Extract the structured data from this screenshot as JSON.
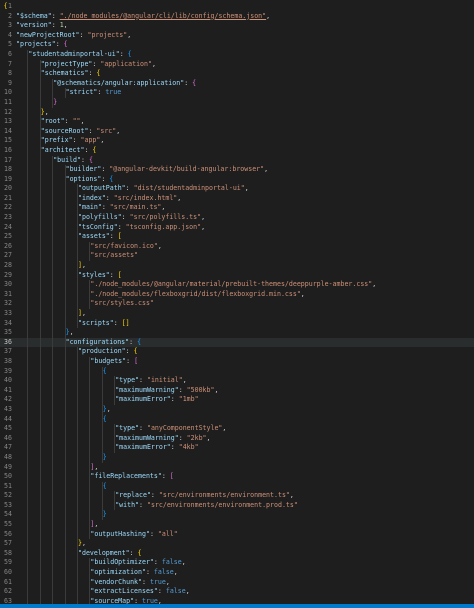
{
  "editor": {
    "file_language": "json",
    "active_line": 36,
    "lines": [
      {
        "n": "1",
        "ind": 0,
        "segs": [
          [
            "{",
            "b0"
          ]
        ]
      },
      {
        "n": "2",
        "ind": 1,
        "segs": [
          [
            "\"$schema\"",
            "key"
          ],
          [
            ": ",
            "p"
          ],
          [
            "\"./node_modules/@angular/cli/lib/config/schema.json\"",
            "link"
          ],
          [
            ",",
            "p"
          ]
        ]
      },
      {
        "n": "3",
        "ind": 1,
        "segs": [
          [
            "\"version\"",
            "key"
          ],
          [
            ": ",
            "p"
          ],
          [
            "1",
            "num"
          ],
          [
            ",",
            "p"
          ]
        ]
      },
      {
        "n": "4",
        "ind": 1,
        "segs": [
          [
            "\"newProjectRoot\"",
            "key"
          ],
          [
            ": ",
            "p"
          ],
          [
            "\"projects\"",
            "str"
          ],
          [
            ",",
            "p"
          ]
        ]
      },
      {
        "n": "5",
        "ind": 1,
        "segs": [
          [
            "\"projects\"",
            "key"
          ],
          [
            ": ",
            "p"
          ],
          [
            "{",
            "b1"
          ]
        ]
      },
      {
        "n": "6",
        "ind": 2,
        "segs": [
          [
            "\"studentadminportal-ui\"",
            "key"
          ],
          [
            ": ",
            "p"
          ],
          [
            "{",
            "b2"
          ]
        ]
      },
      {
        "n": "7",
        "ind": 3,
        "segs": [
          [
            "\"projectType\"",
            "key"
          ],
          [
            ": ",
            "p"
          ],
          [
            "\"application\"",
            "str"
          ],
          [
            ",",
            "p"
          ]
        ]
      },
      {
        "n": "8",
        "ind": 3,
        "segs": [
          [
            "\"schematics\"",
            "key"
          ],
          [
            ": ",
            "p"
          ],
          [
            "{",
            "b0"
          ]
        ]
      },
      {
        "n": "9",
        "ind": 4,
        "segs": [
          [
            "\"@schematics/angular:application\"",
            "key"
          ],
          [
            ": ",
            "p"
          ],
          [
            "{",
            "b1"
          ]
        ]
      },
      {
        "n": "10",
        "ind": 5,
        "segs": [
          [
            "\"strict\"",
            "key"
          ],
          [
            ": ",
            "p"
          ],
          [
            "true",
            "bool"
          ]
        ]
      },
      {
        "n": "11",
        "ind": 4,
        "segs": [
          [
            "}",
            "b1"
          ]
        ]
      },
      {
        "n": "12",
        "ind": 3,
        "segs": [
          [
            "}",
            "b0"
          ],
          [
            ",",
            "p"
          ]
        ]
      },
      {
        "n": "13",
        "ind": 3,
        "segs": [
          [
            "\"root\"",
            "key"
          ],
          [
            ": ",
            "p"
          ],
          [
            "\"\"",
            "str"
          ],
          [
            ",",
            "p"
          ]
        ]
      },
      {
        "n": "14",
        "ind": 3,
        "segs": [
          [
            "\"sourceRoot\"",
            "key"
          ],
          [
            ": ",
            "p"
          ],
          [
            "\"src\"",
            "str"
          ],
          [
            ",",
            "p"
          ]
        ]
      },
      {
        "n": "15",
        "ind": 3,
        "segs": [
          [
            "\"prefix\"",
            "key"
          ],
          [
            ": ",
            "p"
          ],
          [
            "\"app\"",
            "str"
          ],
          [
            ",",
            "p"
          ]
        ]
      },
      {
        "n": "16",
        "ind": 3,
        "segs": [
          [
            "\"architect\"",
            "key"
          ],
          [
            ": ",
            "p"
          ],
          [
            "{",
            "b0"
          ]
        ]
      },
      {
        "n": "17",
        "ind": 4,
        "segs": [
          [
            "\"build\"",
            "key"
          ],
          [
            ": ",
            "p"
          ],
          [
            "{",
            "b1"
          ]
        ]
      },
      {
        "n": "18",
        "ind": 5,
        "segs": [
          [
            "\"builder\"",
            "key"
          ],
          [
            ": ",
            "p"
          ],
          [
            "\"@angular-devkit/build-angular:browser\"",
            "str"
          ],
          [
            ",",
            "p"
          ]
        ]
      },
      {
        "n": "19",
        "ind": 5,
        "segs": [
          [
            "\"options\"",
            "key"
          ],
          [
            ": ",
            "p"
          ],
          [
            "{",
            "b2"
          ]
        ]
      },
      {
        "n": "20",
        "ind": 6,
        "segs": [
          [
            "\"outputPath\"",
            "key"
          ],
          [
            ": ",
            "p"
          ],
          [
            "\"dist/studentadminportal-ui\"",
            "str"
          ],
          [
            ",",
            "p"
          ]
        ]
      },
      {
        "n": "21",
        "ind": 6,
        "segs": [
          [
            "\"index\"",
            "key"
          ],
          [
            ": ",
            "p"
          ],
          [
            "\"src/index.html\"",
            "str"
          ],
          [
            ",",
            "p"
          ]
        ]
      },
      {
        "n": "22",
        "ind": 6,
        "segs": [
          [
            "\"main\"",
            "key"
          ],
          [
            ": ",
            "p"
          ],
          [
            "\"src/main.ts\"",
            "str"
          ],
          [
            ",",
            "p"
          ]
        ]
      },
      {
        "n": "23",
        "ind": 6,
        "segs": [
          [
            "\"polyfills\"",
            "key"
          ],
          [
            ": ",
            "p"
          ],
          [
            "\"src/polyfills.ts\"",
            "str"
          ],
          [
            ",",
            "p"
          ]
        ]
      },
      {
        "n": "24",
        "ind": 6,
        "segs": [
          [
            "\"tsConfig\"",
            "key"
          ],
          [
            ": ",
            "p"
          ],
          [
            "\"tsconfig.app.json\"",
            "str"
          ],
          [
            ",",
            "p"
          ]
        ]
      },
      {
        "n": "25",
        "ind": 6,
        "segs": [
          [
            "\"assets\"",
            "key"
          ],
          [
            ": ",
            "p"
          ],
          [
            "[",
            "b0"
          ]
        ]
      },
      {
        "n": "26",
        "ind": 7,
        "segs": [
          [
            "\"src/favicon.ico\"",
            "str"
          ],
          [
            ",",
            "p"
          ]
        ]
      },
      {
        "n": "27",
        "ind": 7,
        "segs": [
          [
            "\"src/assets\"",
            "str"
          ]
        ]
      },
      {
        "n": "28",
        "ind": 6,
        "segs": [
          [
            "]",
            "b0"
          ],
          [
            ",",
            "p"
          ]
        ]
      },
      {
        "n": "29",
        "ind": 6,
        "segs": [
          [
            "\"styles\"",
            "key"
          ],
          [
            ": ",
            "p"
          ],
          [
            "[",
            "b0"
          ]
        ]
      },
      {
        "n": "30",
        "ind": 7,
        "segs": [
          [
            "\"./node_modules/@angular/material/prebuilt-themes/deeppurple-amber.css\"",
            "str"
          ],
          [
            ",",
            "p"
          ]
        ]
      },
      {
        "n": "31",
        "ind": 7,
        "segs": [
          [
            "\"./node_modules/flexboxgrid/dist/flexboxgrid.min.css\"",
            "str"
          ],
          [
            ",",
            "p"
          ]
        ]
      },
      {
        "n": "32",
        "ind": 7,
        "segs": [
          [
            "\"src/styles.css\"",
            "str"
          ]
        ]
      },
      {
        "n": "33",
        "ind": 6,
        "segs": [
          [
            "]",
            "b0"
          ],
          [
            ",",
            "p"
          ]
        ]
      },
      {
        "n": "34",
        "ind": 6,
        "segs": [
          [
            "\"scripts\"",
            "key"
          ],
          [
            ": ",
            "p"
          ],
          [
            "[]",
            "b0"
          ]
        ]
      },
      {
        "n": "35",
        "ind": 5,
        "segs": [
          [
            "}",
            "b2"
          ],
          [
            ",",
            "p"
          ]
        ]
      },
      {
        "n": "36",
        "ind": 5,
        "segs": [
          [
            "\"configurations\"",
            "key"
          ],
          [
            ": ",
            "p"
          ],
          [
            "{",
            "b2"
          ]
        ]
      },
      {
        "n": "37",
        "ind": 6,
        "segs": [
          [
            "\"production\"",
            "key"
          ],
          [
            ": ",
            "p"
          ],
          [
            "{",
            "b0"
          ]
        ]
      },
      {
        "n": "38",
        "ind": 7,
        "segs": [
          [
            "\"budgets\"",
            "key"
          ],
          [
            ": ",
            "p"
          ],
          [
            "[",
            "b1"
          ]
        ]
      },
      {
        "n": "39",
        "ind": 8,
        "segs": [
          [
            "{",
            "b2"
          ]
        ]
      },
      {
        "n": "40",
        "ind": 9,
        "segs": [
          [
            "\"type\"",
            "key"
          ],
          [
            ": ",
            "p"
          ],
          [
            "\"initial\"",
            "str"
          ],
          [
            ",",
            "p"
          ]
        ]
      },
      {
        "n": "41",
        "ind": 9,
        "segs": [
          [
            "\"maximumWarning\"",
            "key"
          ],
          [
            ": ",
            "p"
          ],
          [
            "\"500kb\"",
            "str"
          ],
          [
            ",",
            "p"
          ]
        ]
      },
      {
        "n": "42",
        "ind": 9,
        "segs": [
          [
            "\"maximumError\"",
            "key"
          ],
          [
            ": ",
            "p"
          ],
          [
            "\"1mb\"",
            "str"
          ]
        ]
      },
      {
        "n": "43",
        "ind": 8,
        "segs": [
          [
            "}",
            "b2"
          ],
          [
            ",",
            "p"
          ]
        ]
      },
      {
        "n": "44",
        "ind": 8,
        "segs": [
          [
            "{",
            "b2"
          ]
        ]
      },
      {
        "n": "45",
        "ind": 9,
        "segs": [
          [
            "\"type\"",
            "key"
          ],
          [
            ": ",
            "p"
          ],
          [
            "\"anyComponentStyle\"",
            "str"
          ],
          [
            ",",
            "p"
          ]
        ]
      },
      {
        "n": "46",
        "ind": 9,
        "segs": [
          [
            "\"maximumWarning\"",
            "key"
          ],
          [
            ": ",
            "p"
          ],
          [
            "\"2kb\"",
            "str"
          ],
          [
            ",",
            "p"
          ]
        ]
      },
      {
        "n": "47",
        "ind": 9,
        "segs": [
          [
            "\"maximumError\"",
            "key"
          ],
          [
            ": ",
            "p"
          ],
          [
            "\"4kb\"",
            "str"
          ]
        ]
      },
      {
        "n": "48",
        "ind": 8,
        "segs": [
          [
            "}",
            "b2"
          ]
        ]
      },
      {
        "n": "49",
        "ind": 7,
        "segs": [
          [
            "]",
            "b1"
          ],
          [
            ",",
            "p"
          ]
        ]
      },
      {
        "n": "50",
        "ind": 7,
        "segs": [
          [
            "\"fileReplacements\"",
            "key"
          ],
          [
            ": ",
            "p"
          ],
          [
            "[",
            "b1"
          ]
        ]
      },
      {
        "n": "51",
        "ind": 8,
        "segs": [
          [
            "{",
            "b2"
          ]
        ]
      },
      {
        "n": "52",
        "ind": 9,
        "segs": [
          [
            "\"replace\"",
            "key"
          ],
          [
            ": ",
            "p"
          ],
          [
            "\"src/environments/environment.ts\"",
            "str"
          ],
          [
            ",",
            "p"
          ]
        ]
      },
      {
        "n": "53",
        "ind": 9,
        "segs": [
          [
            "\"with\"",
            "key"
          ],
          [
            ": ",
            "p"
          ],
          [
            "\"src/environments/environment.prod.ts\"",
            "str"
          ]
        ]
      },
      {
        "n": "54",
        "ind": 8,
        "segs": [
          [
            "}",
            "b2"
          ]
        ]
      },
      {
        "n": "55",
        "ind": 7,
        "segs": [
          [
            "]",
            "b1"
          ],
          [
            ",",
            "p"
          ]
        ]
      },
      {
        "n": "56",
        "ind": 7,
        "segs": [
          [
            "\"outputHashing\"",
            "key"
          ],
          [
            ": ",
            "p"
          ],
          [
            "\"all\"",
            "str"
          ]
        ]
      },
      {
        "n": "57",
        "ind": 6,
        "segs": [
          [
            "}",
            "b0"
          ],
          [
            ",",
            "p"
          ]
        ]
      },
      {
        "n": "58",
        "ind": 6,
        "segs": [
          [
            "\"development\"",
            "key"
          ],
          [
            ": ",
            "p"
          ],
          [
            "{",
            "b0"
          ]
        ]
      },
      {
        "n": "59",
        "ind": 7,
        "segs": [
          [
            "\"buildOptimizer\"",
            "key"
          ],
          [
            ": ",
            "p"
          ],
          [
            "false",
            "bool"
          ],
          [
            ",",
            "p"
          ]
        ]
      },
      {
        "n": "60",
        "ind": 7,
        "segs": [
          [
            "\"optimization\"",
            "key"
          ],
          [
            ": ",
            "p"
          ],
          [
            "false",
            "bool"
          ],
          [
            ",",
            "p"
          ]
        ]
      },
      {
        "n": "61",
        "ind": 7,
        "segs": [
          [
            "\"vendorChunk\"",
            "key"
          ],
          [
            ": ",
            "p"
          ],
          [
            "true",
            "bool"
          ],
          [
            ",",
            "p"
          ]
        ]
      },
      {
        "n": "62",
        "ind": 7,
        "segs": [
          [
            "\"extractLicenses\"",
            "key"
          ],
          [
            ": ",
            "p"
          ],
          [
            "false",
            "bool"
          ],
          [
            ",",
            "p"
          ]
        ]
      },
      {
        "n": "63",
        "ind": 7,
        "segs": [
          [
            "\"sourceMap\"",
            "key"
          ],
          [
            ": ",
            "p"
          ],
          [
            "true",
            "bool"
          ],
          [
            ",",
            "p"
          ]
        ]
      }
    ]
  },
  "theme": {
    "background": "#1e1e1e",
    "line_number": "#858585",
    "key": "#9cdcfe",
    "string": "#ce9178",
    "number": "#b5cea8",
    "boolean": "#569cd6",
    "bracket_gold": "#ffd700",
    "bracket_orchid": "#da70d6",
    "bracket_blue": "#179fff",
    "statusbar": "#007acc"
  }
}
